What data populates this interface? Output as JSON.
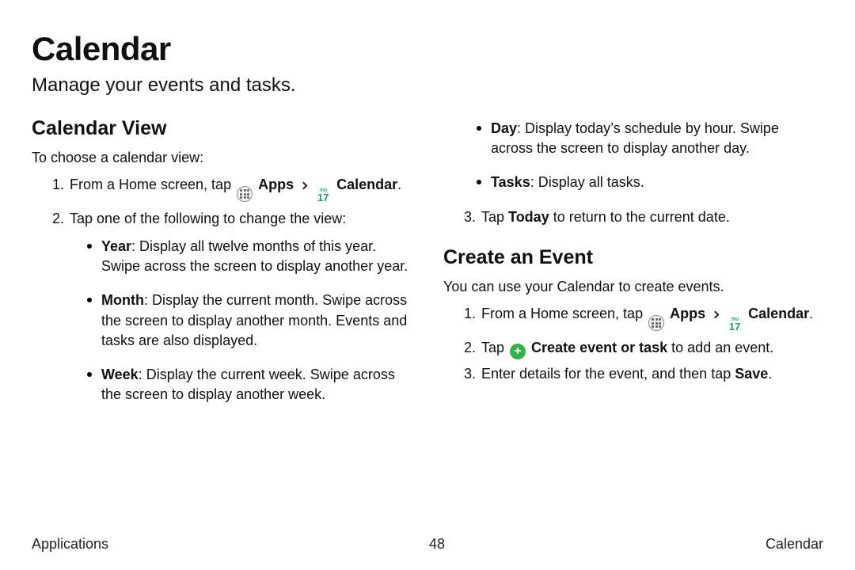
{
  "title": "Calendar",
  "subtitle": "Manage your events and tasks.",
  "left": {
    "heading": "Calendar View",
    "lead": "To choose a calendar view:",
    "step1_pre": "From a Home screen, tap ",
    "apps_label": "Apps",
    "calendar_label": "Calendar",
    "period": ".",
    "step2": "Tap one of the following to change the view:",
    "bullets": {
      "year_label": "Year",
      "year_text": ": Display all twelve months of this year. Swipe across the screen to display another year.",
      "month_label": "Month",
      "month_text": ": Display the current month. Swipe across the screen to display another month. Events and tasks are also displayed.",
      "week_label": "Week",
      "week_text": ": Display the current week. Swipe across the screen to display another week."
    }
  },
  "right": {
    "bullets": {
      "day_label": "Day",
      "day_text": ": Display today’s schedule by hour. Swipe across the screen to display another day.",
      "tasks_label": "Tasks",
      "tasks_text": ": Display all tasks."
    },
    "step3_pre": "Tap ",
    "today_label": "Today",
    "step3_post": " to return to the current date.",
    "heading2": "Create an Event",
    "lead2": "You can use your Calendar to create events.",
    "evt_step1_pre": "From a Home screen, tap ",
    "apps_label": "Apps",
    "calendar_label": "Calendar",
    "period": ".",
    "evt_step2_pre": "Tap ",
    "create_label": "Create event or task",
    "evt_step2_post": " to add an event.",
    "evt_step3_pre": "Enter details for the event, and then tap ",
    "save_label": "Save",
    "evt_step3_post": "."
  },
  "cal_icon": {
    "thu": "THU",
    "num": "17"
  },
  "plus_glyph": "+",
  "footer": {
    "left": "Applications",
    "center": "48",
    "right": "Calendar"
  }
}
